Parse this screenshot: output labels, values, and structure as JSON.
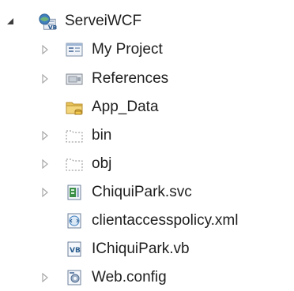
{
  "solution_explorer": {
    "root": {
      "label": "ServeiWCF",
      "icon": "web-project-globe-icon",
      "expanded": true
    },
    "items": [
      {
        "label": "My Project",
        "icon": "my-project-properties-icon",
        "has_children": true
      },
      {
        "label": "References",
        "icon": "references-icon",
        "has_children": true
      },
      {
        "label": "App_Data",
        "icon": "app-data-folder-icon",
        "has_children": false
      },
      {
        "label": "bin",
        "icon": "folder-dotted-icon",
        "has_children": true
      },
      {
        "label": "obj",
        "icon": "folder-dotted-icon",
        "has_children": true
      },
      {
        "label": "ChiquiPark.svc",
        "icon": "svc-file-icon",
        "has_children": true
      },
      {
        "label": "clientaccesspolicy.xml",
        "icon": "xml-file-icon",
        "has_children": false
      },
      {
        "label": "IChiquiPark.vb",
        "icon": "vb-file-icon",
        "has_children": false
      },
      {
        "label": "Web.config",
        "icon": "config-file-icon",
        "has_children": true
      }
    ]
  },
  "colors": {
    "text": "#1e1e1e",
    "expander": "#a8a8a8",
    "expander_open": "#3c3c3c",
    "folder_yellow": "#e8c35a",
    "globe_blue": "#3f7fbf"
  }
}
